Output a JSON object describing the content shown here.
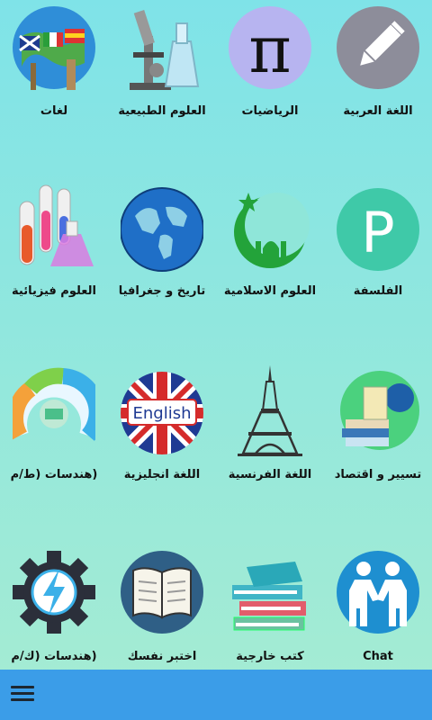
{
  "tiles": [
    {
      "id": "arabic",
      "label": "اللغة العربية",
      "icon": "pencil-icon"
    },
    {
      "id": "math",
      "label": "الرياضيات",
      "icon": "pi-icon"
    },
    {
      "id": "natural-sciences",
      "label": "العلوم الطبيعية",
      "icon": "microscope-icon"
    },
    {
      "id": "languages",
      "label": "لغات",
      "icon": "globe-flags-icon"
    },
    {
      "id": "philosophy",
      "label": "الفلسفة",
      "icon": "philosophy-p-icon"
    },
    {
      "id": "islamic",
      "label": "العلوم الاسلامية",
      "icon": "crescent-mosque-icon"
    },
    {
      "id": "history-geo",
      "label": "تاريخ و جغرافيا",
      "icon": "globe-icon"
    },
    {
      "id": "physics",
      "label": "العلوم فيزيائية",
      "icon": "test-tubes-icon"
    },
    {
      "id": "economics",
      "label": "تسيير و اقتصاد",
      "icon": "books-globe-icon"
    },
    {
      "id": "french",
      "label": "اللغة الفرنسية",
      "icon": "eiffel-tower-icon"
    },
    {
      "id": "english",
      "label": "اللغة انجليزية",
      "icon": "english-flag-icon",
      "badge": "English"
    },
    {
      "id": "engineering-tm",
      "label": "(هندسات (ط/م",
      "icon": "engineering-horseshoe-icon"
    },
    {
      "id": "chat",
      "label": "Chat",
      "icon": "chat-people-icon"
    },
    {
      "id": "external-books",
      "label": "كتب خارجية",
      "icon": "book-stack-icon"
    },
    {
      "id": "test-yourself",
      "label": "اختبر نفسك",
      "icon": "open-book-icon"
    },
    {
      "id": "engineering-km",
      "label": "(هندسات (ك/م",
      "icon": "gear-lightning-icon"
    }
  ],
  "pi_symbol": "π",
  "p_symbol": "P",
  "colors": {
    "bottom_bar": "#3b9de8",
    "pencil_circle": "#8d8d9a",
    "pi_circle": "#b7b4f0",
    "philosophy_circle": "#3fc9a8",
    "islamic_green": "#23a33a",
    "chat_circle": "#1e8fd0",
    "gear_dark": "#2b2f3a"
  },
  "bottom_bar": {
    "menu_icon": "hamburger-menu-icon"
  }
}
